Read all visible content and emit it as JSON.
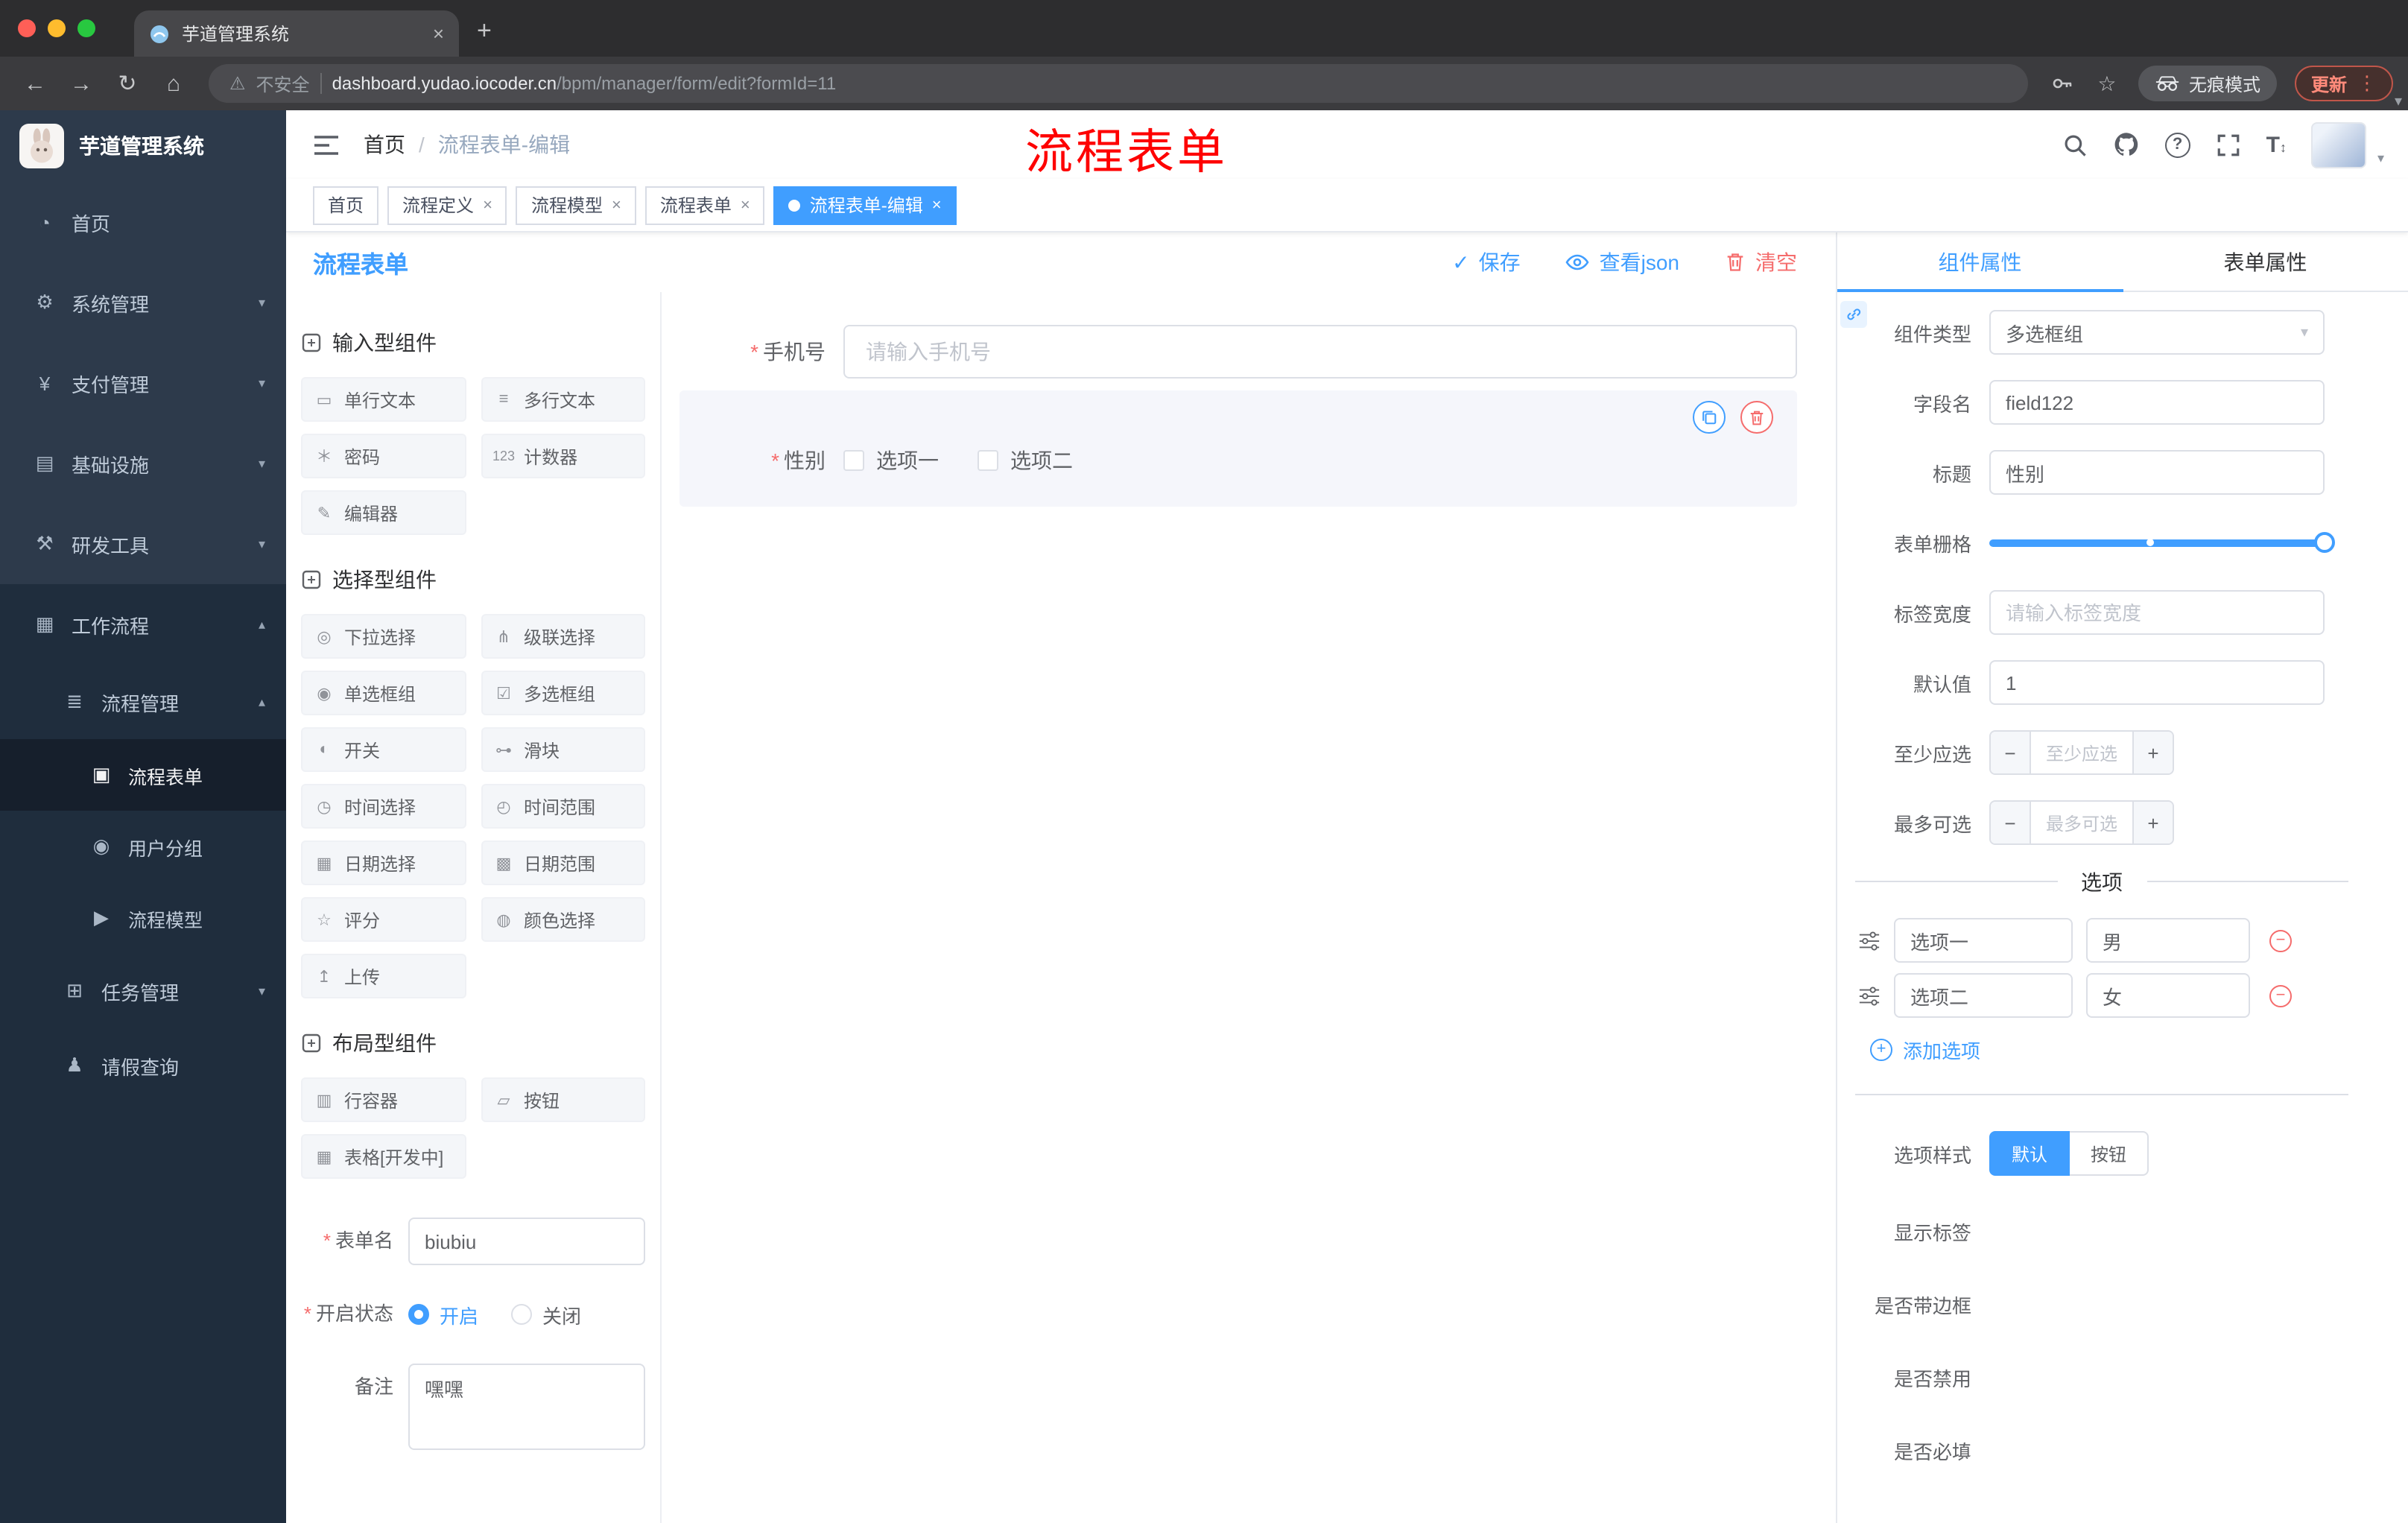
{
  "glyphs": {
    "close": "×",
    "plus": "+",
    "minus": "−",
    "back": "←",
    "forward": "→",
    "reload": "↻",
    "home": "⌂",
    "warning": "⚠",
    "dots": "⋮",
    "caret_down": "▾",
    "check": "✓",
    "question": "?",
    "text_size": "T",
    "updown": "↕",
    "star": "☆",
    "pipe": "|"
  },
  "browser": {
    "tab_title": "芋道管理系统",
    "security_label": "不安全",
    "url_host": "dashboard.yudao.iocoder.cn",
    "url_path": "/bpm/manager/form/edit?formId=11",
    "incognito_label": "无痕模式",
    "update_label": "更新"
  },
  "sidebar": {
    "logo_title": "芋道管理系统",
    "items": [
      {
        "label": "首页",
        "icon": "◔",
        "arrow": ""
      },
      {
        "label": "系统管理",
        "icon": "⚙",
        "arrow": "▾"
      },
      {
        "label": "支付管理",
        "icon": "¥",
        "arrow": "▾"
      },
      {
        "label": "基础设施",
        "icon": "▤",
        "arrow": "▾"
      },
      {
        "label": "研发工具",
        "icon": "⚒",
        "arrow": "▾"
      },
      {
        "label": "工作流程",
        "icon": "▦",
        "arrow": "▴"
      },
      {
        "label": "流程管理",
        "icon": "≣",
        "arrow": "▴"
      },
      {
        "label": "流程表单",
        "icon": "▣",
        "arrow": ""
      },
      {
        "label": "用户分组",
        "icon": "◉",
        "arrow": ""
      },
      {
        "label": "流程模型",
        "icon": "▶",
        "arrow": ""
      },
      {
        "label": "任务管理",
        "icon": "⊞",
        "arrow": "▾"
      },
      {
        "label": "请假查询",
        "icon": "♟",
        "arrow": ""
      }
    ]
  },
  "header": {
    "breadcrumb_home": "首页",
    "breadcrumb_sep": "/",
    "breadcrumb_current": "流程表单-编辑",
    "annotation": "流程表单"
  },
  "tags": [
    {
      "label": "首页",
      "closable": false,
      "active": false
    },
    {
      "label": "流程定义",
      "closable": true,
      "active": false
    },
    {
      "label": "流程模型",
      "closable": true,
      "active": false
    },
    {
      "label": "流程表单",
      "closable": true,
      "active": false
    },
    {
      "label": "流程表单-编辑",
      "closable": true,
      "active": true
    }
  ],
  "designer": {
    "panel_title": "流程表单",
    "save_label": "保存",
    "view_json_label": "查看json",
    "clear_label": "清空"
  },
  "palette": [
    {
      "title": "输入型组件",
      "items": [
        {
          "icon": "▭",
          "label": "单行文本"
        },
        {
          "icon": "≡",
          "label": "多行文本"
        },
        {
          "icon": "＊",
          "label": "密码"
        },
        {
          "icon": "123",
          "label": "计数器"
        },
        {
          "icon": "✎",
          "label": "编辑器"
        }
      ]
    },
    {
      "title": "选择型组件",
      "items": [
        {
          "icon": "◎",
          "label": "下拉选择"
        },
        {
          "icon": "⋔",
          "label": "级联选择"
        },
        {
          "icon": "◉",
          "label": "单选框组"
        },
        {
          "icon": "☑",
          "label": "多选框组"
        },
        {
          "icon": "◐",
          "label": "开关"
        },
        {
          "icon": "⊶",
          "label": "滑块"
        },
        {
          "icon": "◷",
          "label": "时间选择"
        },
        {
          "icon": "◴",
          "label": "时间范围"
        },
        {
          "icon": "▦",
          "label": "日期选择"
        },
        {
          "icon": "▩",
          "label": "日期范围"
        },
        {
          "icon": "☆",
          "label": "评分"
        },
        {
          "icon": "◍",
          "label": "颜色选择"
        },
        {
          "icon": "↥",
          "label": "上传"
        }
      ]
    },
    {
      "title": "布局型组件",
      "items": [
        {
          "icon": "▥",
          "label": "行容器"
        },
        {
          "icon": "▱",
          "label": "按钮"
        },
        {
          "icon": "▦",
          "label": "表格[开发中]"
        }
      ]
    }
  ],
  "meta": {
    "name_label": "表单名",
    "name_value": "biubiu",
    "status_label": "开启状态",
    "status_on": "开启",
    "status_off": "关闭",
    "status_value": "开启",
    "remark_label": "备注",
    "remark_value": "嘿嘿"
  },
  "canvas": {
    "phone_label": "手机号",
    "phone_placeholder": "请输入手机号",
    "gender_label": "性别",
    "gender_option1": "选项一",
    "gender_option2": "选项二"
  },
  "props": {
    "tab_component": "组件属性",
    "tab_form": "表单属性",
    "type_label": "组件类型",
    "type_value": "多选框组",
    "field_label": "字段名",
    "field_value": "field122",
    "title_label": "标题",
    "title_value": "性别",
    "grid_label": "表单栅格",
    "width_label": "标签宽度",
    "width_placeholder": "请输入标签宽度",
    "default_label": "默认值",
    "default_value": "1",
    "min_label": "至少应选",
    "min_placeholder": "至少应选",
    "max_label": "最多可选",
    "max_placeholder": "最多可选",
    "options_title": "选项",
    "options": [
      {
        "label": "选项一",
        "value": "男"
      },
      {
        "label": "选项二",
        "value": "女"
      }
    ],
    "add_option_label": "添加选项",
    "style_label": "选项样式",
    "style_default": "默认",
    "style_button": "按钮",
    "style_value": "默认",
    "switches": [
      {
        "label": "显示标签",
        "on": true
      },
      {
        "label": "是否带边框",
        "on": false
      },
      {
        "label": "是否禁用",
        "on": false
      },
      {
        "label": "是否必填",
        "on": true
      }
    ]
  },
  "colors": {
    "accent": "#409eff",
    "danger": "#f56c6c",
    "annotation": "#fe0000"
  }
}
